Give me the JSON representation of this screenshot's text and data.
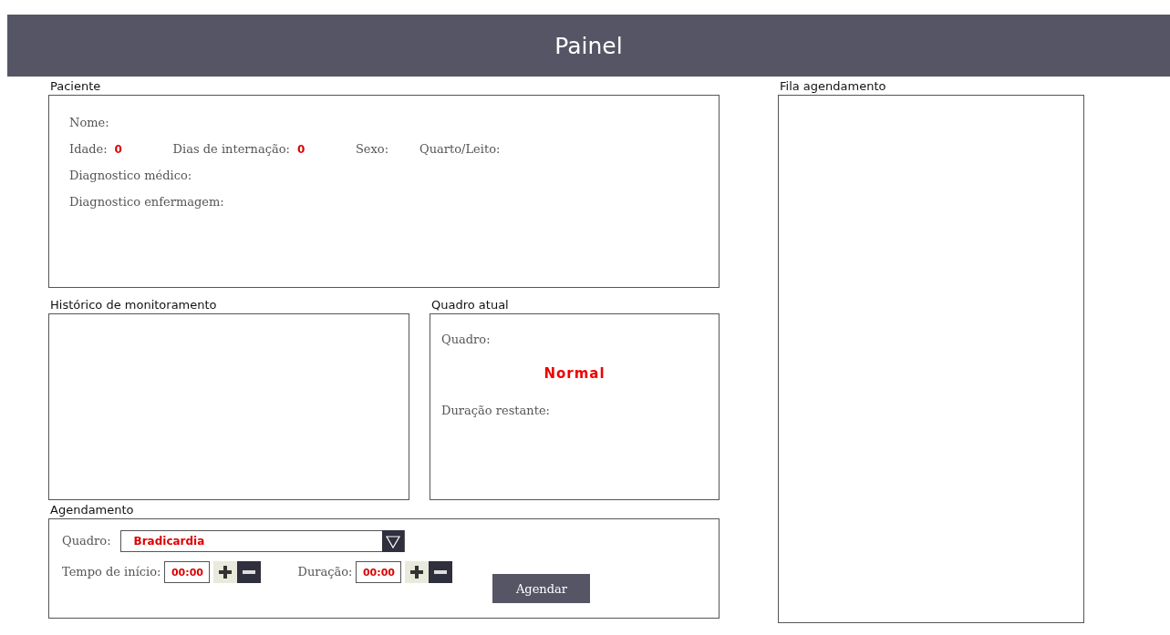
{
  "header": {
    "title": "Painel"
  },
  "patient": {
    "title": "Paciente",
    "rows": [
      [
        {
          "label": "Nome:"
        }
      ],
      [
        {
          "label": "Idade:",
          "value": "0"
        },
        {
          "label": "Dias de internação:",
          "value": "0"
        },
        {
          "label": "Sexo:"
        },
        {
          "label": "Quarto/Leito:"
        }
      ],
      [
        {
          "label": "Diagnostico médico:"
        }
      ],
      [
        {
          "label": "Diagnostico enfermagem:"
        }
      ]
    ]
  },
  "history": {
    "title": "Histórico de monitoramento"
  },
  "current": {
    "title": "Quadro atual",
    "label": "Quadro:",
    "status": "Normal",
    "remaining_label": "Duração restante:"
  },
  "scheduling": {
    "title": "Agendamento",
    "condition_label": "Quadro:",
    "condition_value": "Bradicardia",
    "times": [
      {
        "label": "Tempo de início:",
        "value": "00:00"
      },
      {
        "label": "Duração:",
        "value": "00:00"
      }
    ],
    "button": "Agendar"
  },
  "queue": {
    "title": "Fila agendamento"
  }
}
